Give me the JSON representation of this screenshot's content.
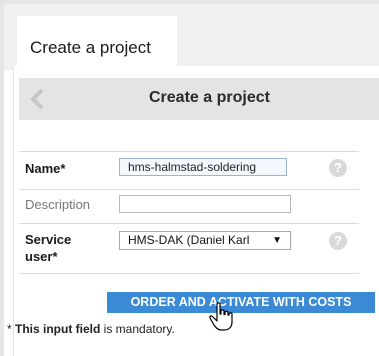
{
  "tab": {
    "label": "Create a project"
  },
  "header": {
    "title": "Create a project"
  },
  "form": {
    "name": {
      "label": "Name*",
      "value": "hms-halmstad-soldering"
    },
    "description": {
      "label": "Description",
      "value": ""
    },
    "service_user": {
      "label": "Service user*",
      "selected": "HMS-DAK (Daniel Karl"
    }
  },
  "help_glyph": "?",
  "actions": {
    "order_label": "ORDER AND ACTIVATE WITH COSTS"
  },
  "footnote": {
    "prefix": "* ",
    "bold": "This input field",
    "suffix": " is mandatory."
  },
  "colors": {
    "accent": "#3b8ad6",
    "header_bg": "#e4e4e4",
    "tabbar_bg": "#f0f0f0"
  }
}
